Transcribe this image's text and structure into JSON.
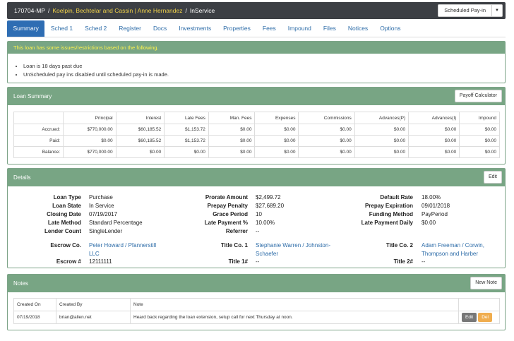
{
  "header": {
    "loan_id": "170704-MP",
    "lender": "Koelpin, Bechtelar and Cassin | Anne Hernandez",
    "state": "InService",
    "sched_button": "Scheduled Pay-in"
  },
  "tabs": [
    "Summary",
    "Sched 1",
    "Sched 2",
    "Register",
    "Docs",
    "Investments",
    "Properties",
    "Fees",
    "Impound",
    "Files",
    "Notices",
    "Options"
  ],
  "alert": {
    "title": "This loan has some issues/restrictions based on the following.",
    "items": [
      "Loan is 18 days past due",
      "UnScheduled pay ins disabled until scheduled pay-in is made."
    ]
  },
  "loan_summary": {
    "title": "Loan Summary",
    "payoff_button": "Payoff Calculator",
    "columns": [
      "Principal",
      "Interest",
      "Late Fees",
      "Man. Fees",
      "Expenses",
      "Commissions",
      "Advances(P)",
      "Advances(I)",
      "Impound"
    ],
    "rows": [
      {
        "label": "Accrued:",
        "values": [
          "$770,000.00",
          "$60,185.52",
          "$1,153.72",
          "$0.00",
          "$0.00",
          "$0.00",
          "$0.00",
          "$0.00",
          "$0.00"
        ]
      },
      {
        "label": "Paid:",
        "values": [
          "$0.00",
          "$60,185.52",
          "$1,153.72",
          "$0.00",
          "$0.00",
          "$0.00",
          "$0.00",
          "$0.00",
          "$0.00"
        ]
      },
      {
        "label": "Balance:",
        "values": [
          "$770,000.00",
          "$0.00",
          "$0.00",
          "$0.00",
          "$0.00",
          "$0.00",
          "$0.00",
          "$0.00",
          "$0.00"
        ]
      }
    ]
  },
  "details": {
    "title": "Details",
    "edit_button": "Edit",
    "loan_type_label": "Loan Type",
    "loan_type": "Purchase",
    "loan_state_label": "Loan State",
    "loan_state": "In Service",
    "closing_date_label": "Closing Date",
    "closing_date": "07/19/2017",
    "late_method_label": "Late Method",
    "late_method": "Standard Percentage",
    "lender_count_label": "Lender Count",
    "lender_count": "SingleLender",
    "prorate_amount_label": "Prorate Amount",
    "prorate_amount": "$2,499.72",
    "prepay_penalty_label": "Prepay Penalty",
    "prepay_penalty": "$27,689.20",
    "grace_period_label": "Grace Period",
    "grace_period": "10",
    "late_payment_pct_label": "Late Payment %",
    "late_payment_pct": "10.00%",
    "referrer_label": "Referrer",
    "referrer": "--",
    "default_rate_label": "Default Rate",
    "default_rate": "18.00%",
    "prepay_expiration_label": "Prepay Expiration",
    "prepay_expiration": "09/01/2018",
    "funding_method_label": "Funding Method",
    "funding_method": "PayPeriod",
    "late_payment_daily_label": "Late Payment Daily",
    "late_payment_daily": "$0.00",
    "escrow_co_label": "Escrow Co.",
    "escrow_co_line1": "Peter Howard / Pfannerstill",
    "escrow_co_line2": "LLC",
    "escrow_no_label": "Escrow #",
    "escrow_no": "12111111",
    "title_co1_label": "Title Co. 1",
    "title_co1_line1": "Stephanie Warren / Johnston-",
    "title_co1_line2": "Schaefer",
    "title_no1_label": "Title 1#",
    "title_no1": "--",
    "title_co2_label": "Title Co. 2",
    "title_co2_line1": "Adam Freeman / Corwin,",
    "title_co2_line2": "Thompson and Harber",
    "title_no2_label": "Title 2#",
    "title_no2": "--"
  },
  "notes": {
    "title": "Notes",
    "new_button": "New Note",
    "columns": [
      "Created On",
      "Created By",
      "Note"
    ],
    "rows": [
      {
        "created_on": "07/19/2018",
        "created_by": "brian@allen.net",
        "note": "Heard back regarding the loan extension, setup call for next Thursday at noon.",
        "edit": "Edit",
        "del": "Del"
      }
    ]
  }
}
